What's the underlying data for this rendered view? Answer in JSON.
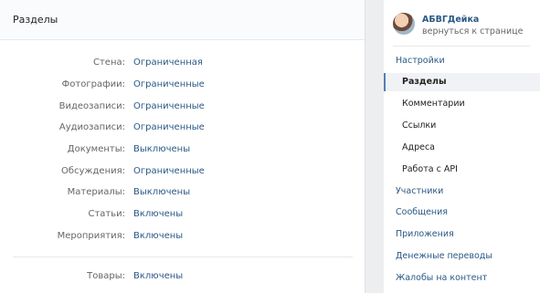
{
  "main": {
    "title": "Разделы",
    "rows": [
      {
        "label": "Стена:",
        "value": "Ограниченная"
      },
      {
        "label": "Фотографии:",
        "value": "Ограниченные"
      },
      {
        "label": "Видеозаписи:",
        "value": "Ограниченные"
      },
      {
        "label": "Аудиозаписи:",
        "value": "Ограниченные"
      },
      {
        "label": "Документы:",
        "value": "Выключены"
      },
      {
        "label": "Обсуждения:",
        "value": "Ограниченные"
      },
      {
        "label": "Материалы:",
        "value": "Выключены"
      },
      {
        "label": "Статьи:",
        "value": "Включены"
      },
      {
        "label": "Мероприятия:",
        "value": "Включены"
      }
    ],
    "goods": {
      "label": "Товары:",
      "value": "Включены"
    }
  },
  "sidebar": {
    "profile_name": "АБВГДейка",
    "back_link": "вернуться к странице",
    "menu": [
      {
        "label": "Настройки"
      },
      {
        "label": "Разделы"
      },
      {
        "label": "Комментарии"
      },
      {
        "label": "Ссылки"
      },
      {
        "label": "Адреса"
      },
      {
        "label": "Работа с API"
      },
      {
        "label": "Участники"
      },
      {
        "label": "Сообщения"
      },
      {
        "label": "Приложения"
      },
      {
        "label": "Денежные переводы"
      },
      {
        "label": "Жалобы на контент"
      }
    ]
  }
}
